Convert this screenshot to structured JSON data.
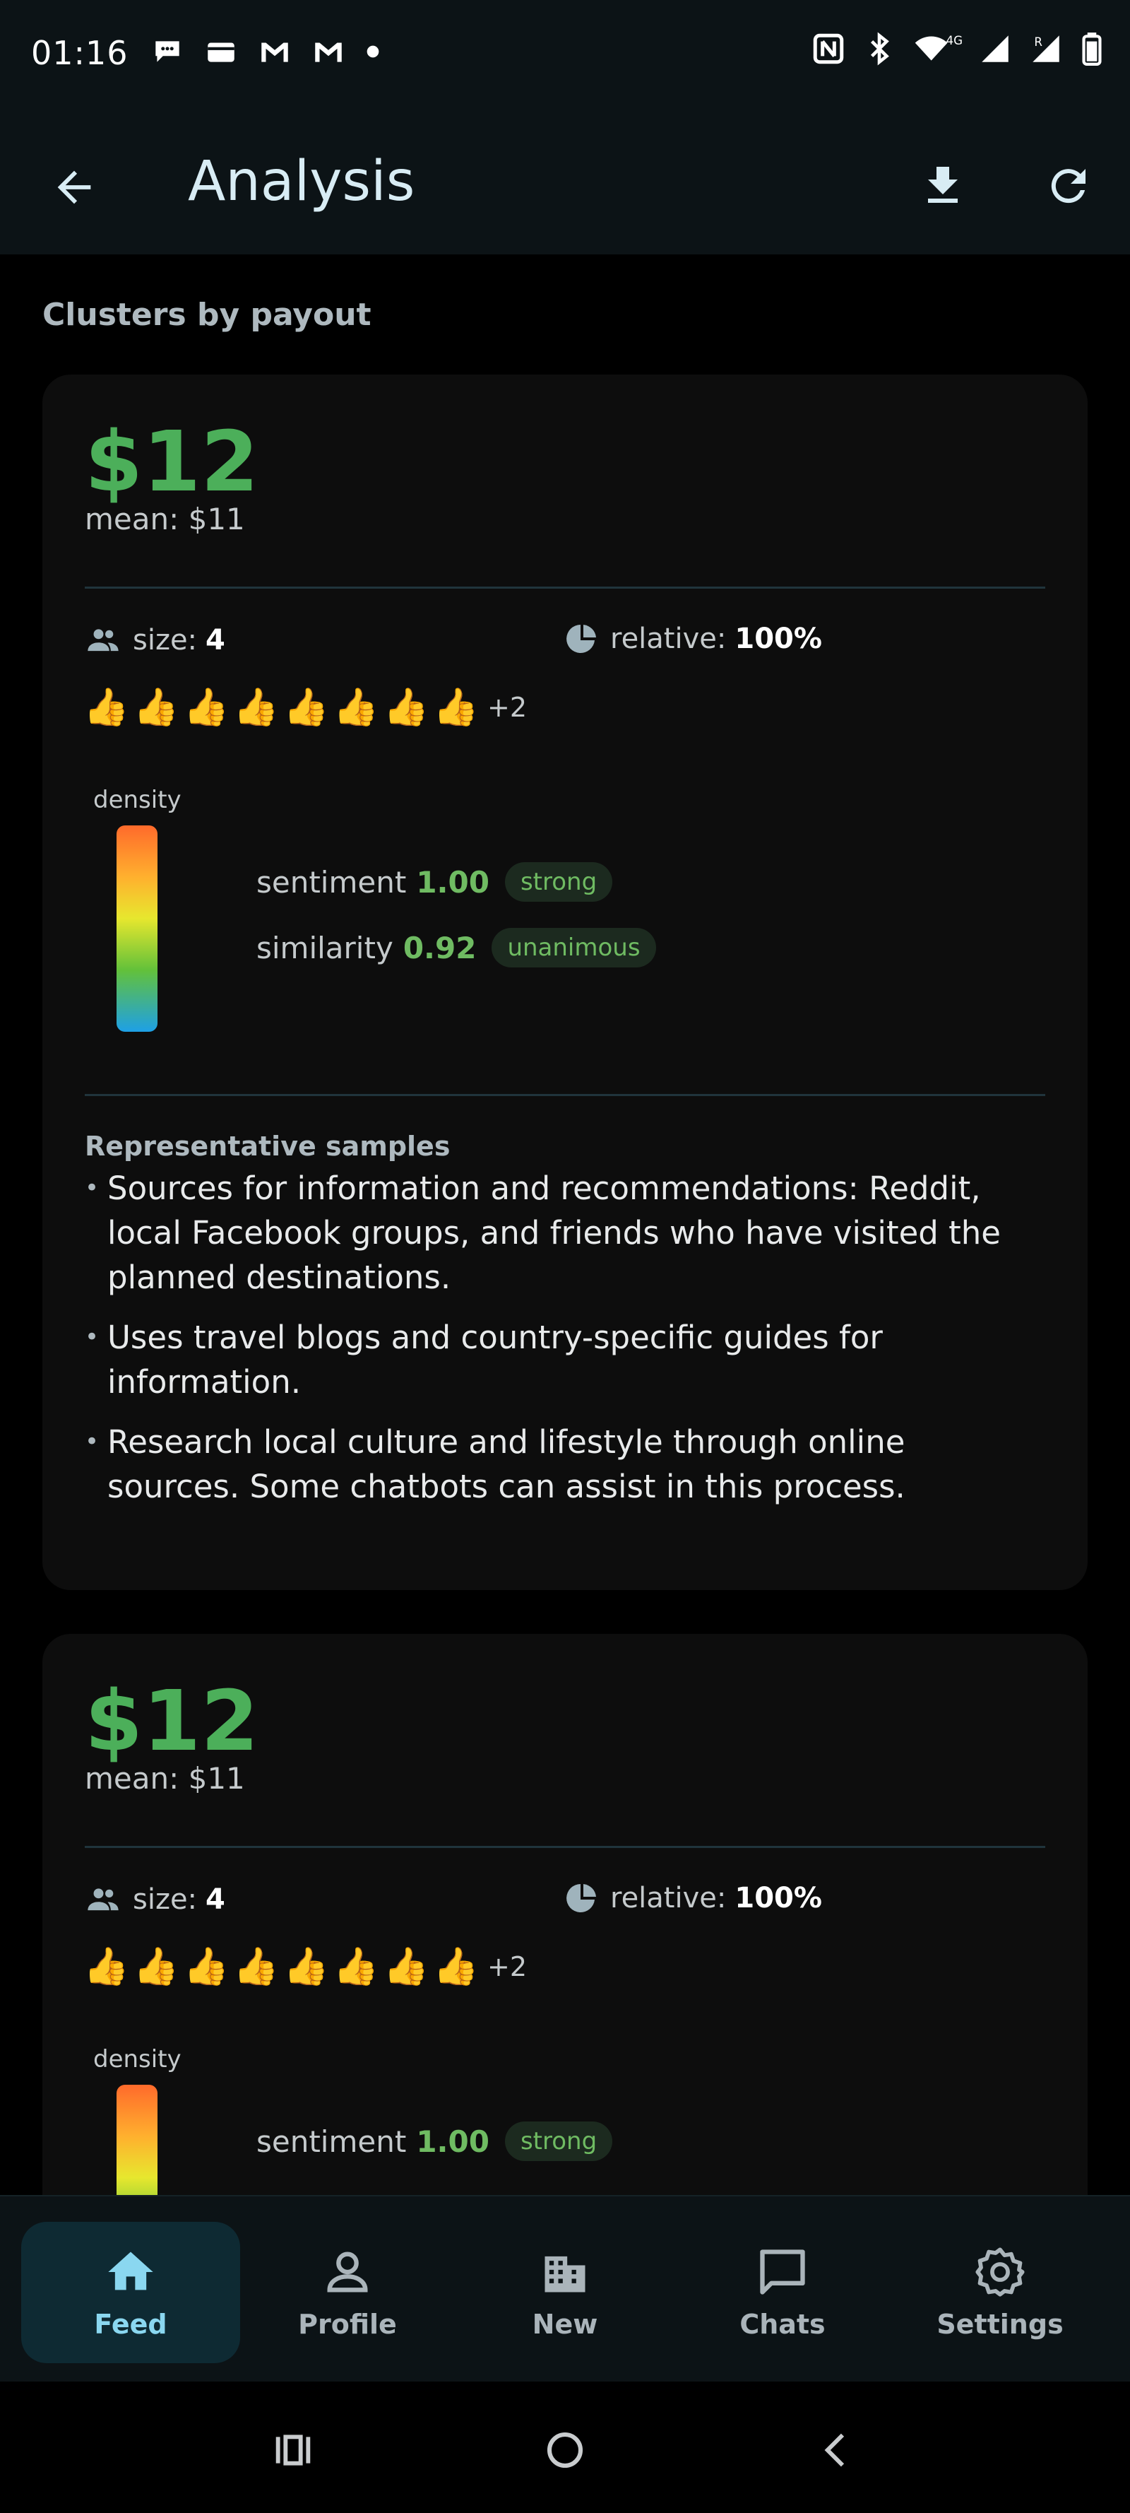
{
  "status_bar": {
    "time": "01:16",
    "network_label": "4G"
  },
  "app_bar": {
    "title": "Analysis",
    "back_icon": "arrow-back-icon",
    "download_icon": "download-icon",
    "refresh_icon": "refresh-icon"
  },
  "section_title": "Clusters by payout",
  "cards": [
    {
      "price": "$12",
      "mean": "mean: $11",
      "size_label": "size:",
      "size_value": "4",
      "relative_label": "relative:",
      "relative_value": "100%",
      "thumbs_count": 8,
      "thumbs_more": "+2",
      "density_label": "density",
      "sentiment_label": "sentiment",
      "sentiment_value": "1.00",
      "sentiment_badge": "strong",
      "similarity_label": "similarity",
      "similarity_value": "0.92",
      "similarity_badge": "unanimous",
      "samples_title": "Representative samples",
      "samples": [
        "Sources for information and recommendations: Reddit, local Facebook groups, and friends who have visited the planned destinations.",
        "Uses travel blogs and country-specific guides for information.",
        "Research local culture and lifestyle through online sources. Some chatbots can assist in this process."
      ]
    },
    {
      "price": "$12",
      "mean": "mean: $11",
      "size_label": "size:",
      "size_value": "4",
      "relative_label": "relative:",
      "relative_value": "100%",
      "thumbs_count": 8,
      "thumbs_more": "+2",
      "density_label": "density",
      "sentiment_label": "sentiment",
      "sentiment_value": "1.00",
      "sentiment_badge": "strong"
    }
  ],
  "bottom_nav": [
    {
      "label": "Feed",
      "icon": "home-icon",
      "active": true
    },
    {
      "label": "Profile",
      "icon": "person-icon",
      "active": false
    },
    {
      "label": "New",
      "icon": "building-icon",
      "active": false
    },
    {
      "label": "Chats",
      "icon": "chat-bubble-icon",
      "active": false
    },
    {
      "label": "Settings",
      "icon": "gear-icon",
      "active": false
    }
  ],
  "colors": {
    "accent_green": "#4caf5a",
    "nav_active": "#8ad7f0",
    "surface": "#0c1316"
  }
}
